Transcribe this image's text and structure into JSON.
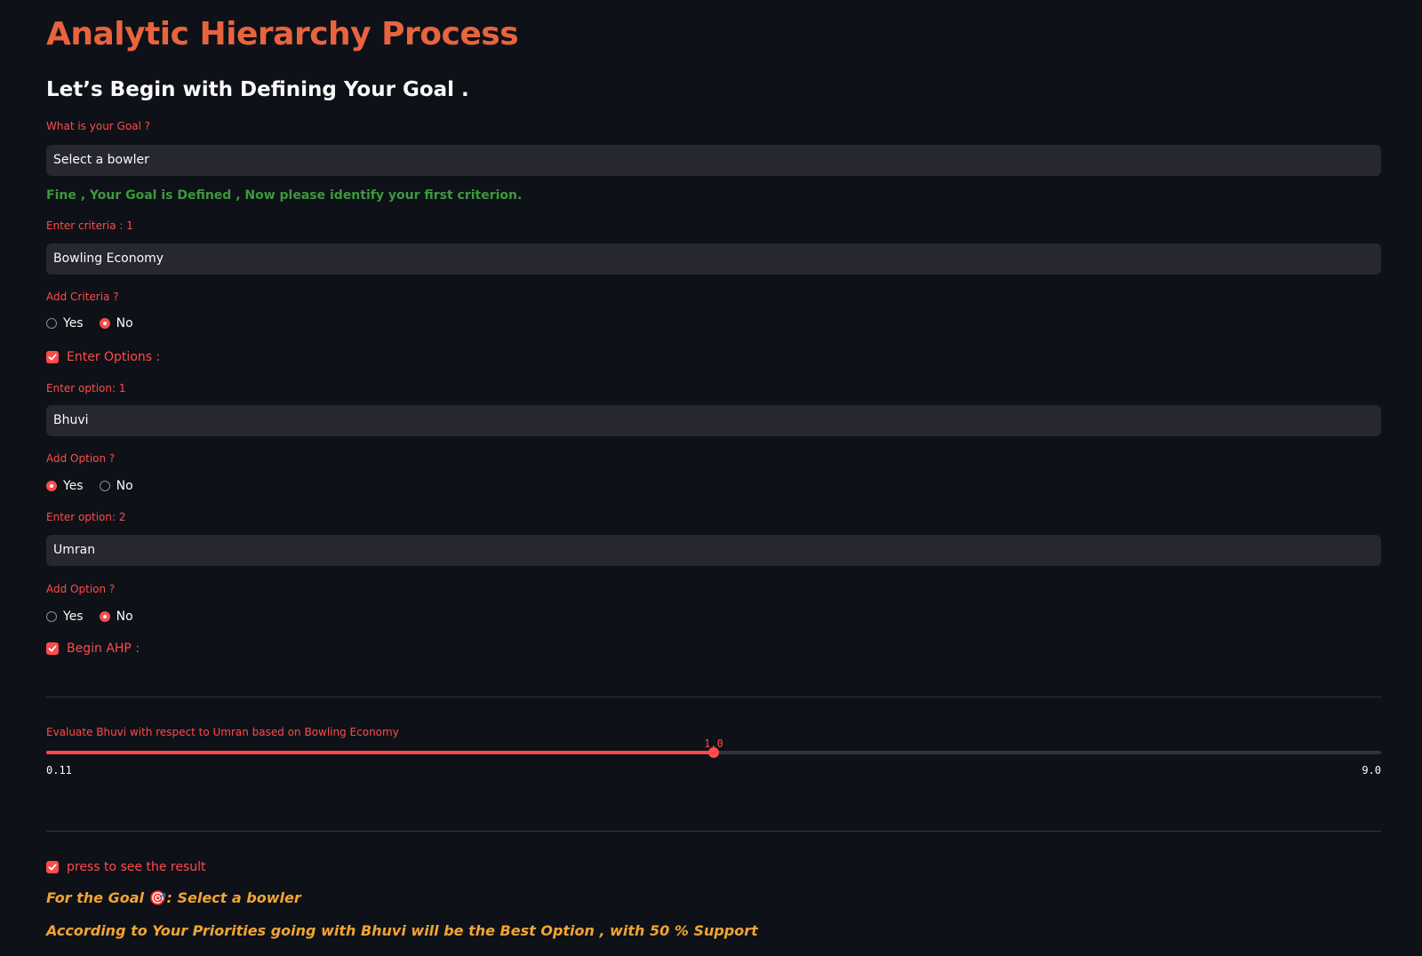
{
  "header": {
    "title": "Analytic Hierarchy Process",
    "subtitle": "Let’s Begin with Defining Your Goal ."
  },
  "goal": {
    "label": "What is your Goal ?",
    "value": "Select a bowler",
    "success_message": "Fine , Your Goal is Defined , Now please identify your first criterion."
  },
  "criteria": {
    "label": "Enter criteria : 1",
    "value": "Bowling Economy"
  },
  "add_criteria": {
    "label": "Add Criteria ?",
    "options": [
      "Yes",
      "No"
    ],
    "selected": "No"
  },
  "enter_options_checkbox": {
    "label": "Enter Options :",
    "checked": true
  },
  "option1": {
    "label": "Enter option: 1",
    "value": "Bhuvi"
  },
  "add_option_1": {
    "label": "Add Option ?",
    "options": [
      "Yes",
      "No"
    ],
    "selected": "Yes"
  },
  "option2": {
    "label": "Enter option: 2",
    "value": "Umran"
  },
  "add_option_2": {
    "label": "Add Option ?",
    "options": [
      "Yes",
      "No"
    ],
    "selected": "No"
  },
  "begin_ahp_checkbox": {
    "label": "Begin AHP :",
    "checked": true
  },
  "evaluation_slider": {
    "label": "Evaluate Bhuvi with respect to Umran based on Bowling Economy",
    "value": "1.0",
    "min": "0.11",
    "max": "9.0",
    "fill_fraction": 0.5
  },
  "result_checkbox": {
    "label": "press to see the result",
    "checked": true
  },
  "result": {
    "goal_prefix": "For the Goal ",
    "goal_icon": "🎯",
    "goal_suffix": ": Select a bowler",
    "best_option_text": "According to Your Priorities going with Bhuvi will be the Best Option , with 50 % Support"
  },
  "colors": {
    "background": "#0e1117",
    "accent": "#ff4b4b",
    "title": "#e8643f",
    "success": "#3b9a3b",
    "result": "#f0a436"
  }
}
